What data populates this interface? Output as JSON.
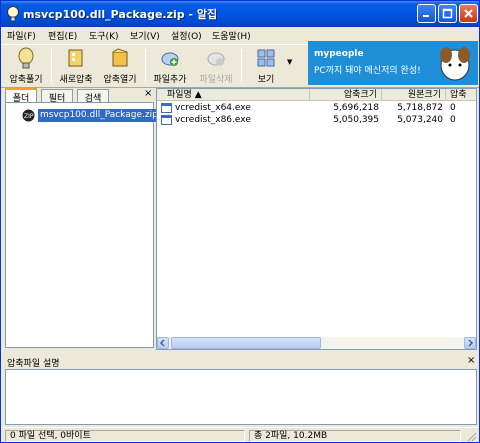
{
  "window": {
    "title": "msvcp100.dll_Package.zip - 알집",
    "titlebar_color": "#0054e3"
  },
  "menu": [
    {
      "label": "파일(F)"
    },
    {
      "label": "편집(E)"
    },
    {
      "label": "도구(K)"
    },
    {
      "label": "보기(V)"
    },
    {
      "label": "설정(O)"
    },
    {
      "label": "도움말(H)"
    }
  ],
  "toolbar": {
    "extract_label": "압축풀기",
    "new_label": "새로압축",
    "open_label": "압축열기",
    "add_label": "파일추가",
    "delete_label": "파일삭제",
    "view_label": "보기"
  },
  "ad": {
    "brand": "mypeople",
    "text": "PC까지 돼야 메신저의 완성!",
    "color": "#1e8fd6"
  },
  "leftpane": {
    "tabs": [
      {
        "label": "폴더"
      },
      {
        "label": "필터"
      },
      {
        "label": "검색"
      }
    ],
    "close_label": "×",
    "tree_node": "msvcp100.dll_Package.zip"
  },
  "filelist": {
    "columns": [
      {
        "label": "파일명 ▲"
      },
      {
        "label": "압축크기"
      },
      {
        "label": "원본크기"
      },
      {
        "label": "압축"
      }
    ],
    "rows": [
      {
        "name": "vcredist_x64.exe",
        "compressed": "5,696,218",
        "original": "5,718,872",
        "ratio": "0"
      },
      {
        "name": "vcredist_x86.exe",
        "compressed": "5,050,395",
        "original": "5,073,240",
        "ratio": "0"
      }
    ]
  },
  "comment": {
    "title": "압축파일 설명",
    "close_label": "×"
  },
  "status": {
    "left": "0 파일 선택, 0바이트",
    "right": "총 2파일, 10.2MB"
  }
}
